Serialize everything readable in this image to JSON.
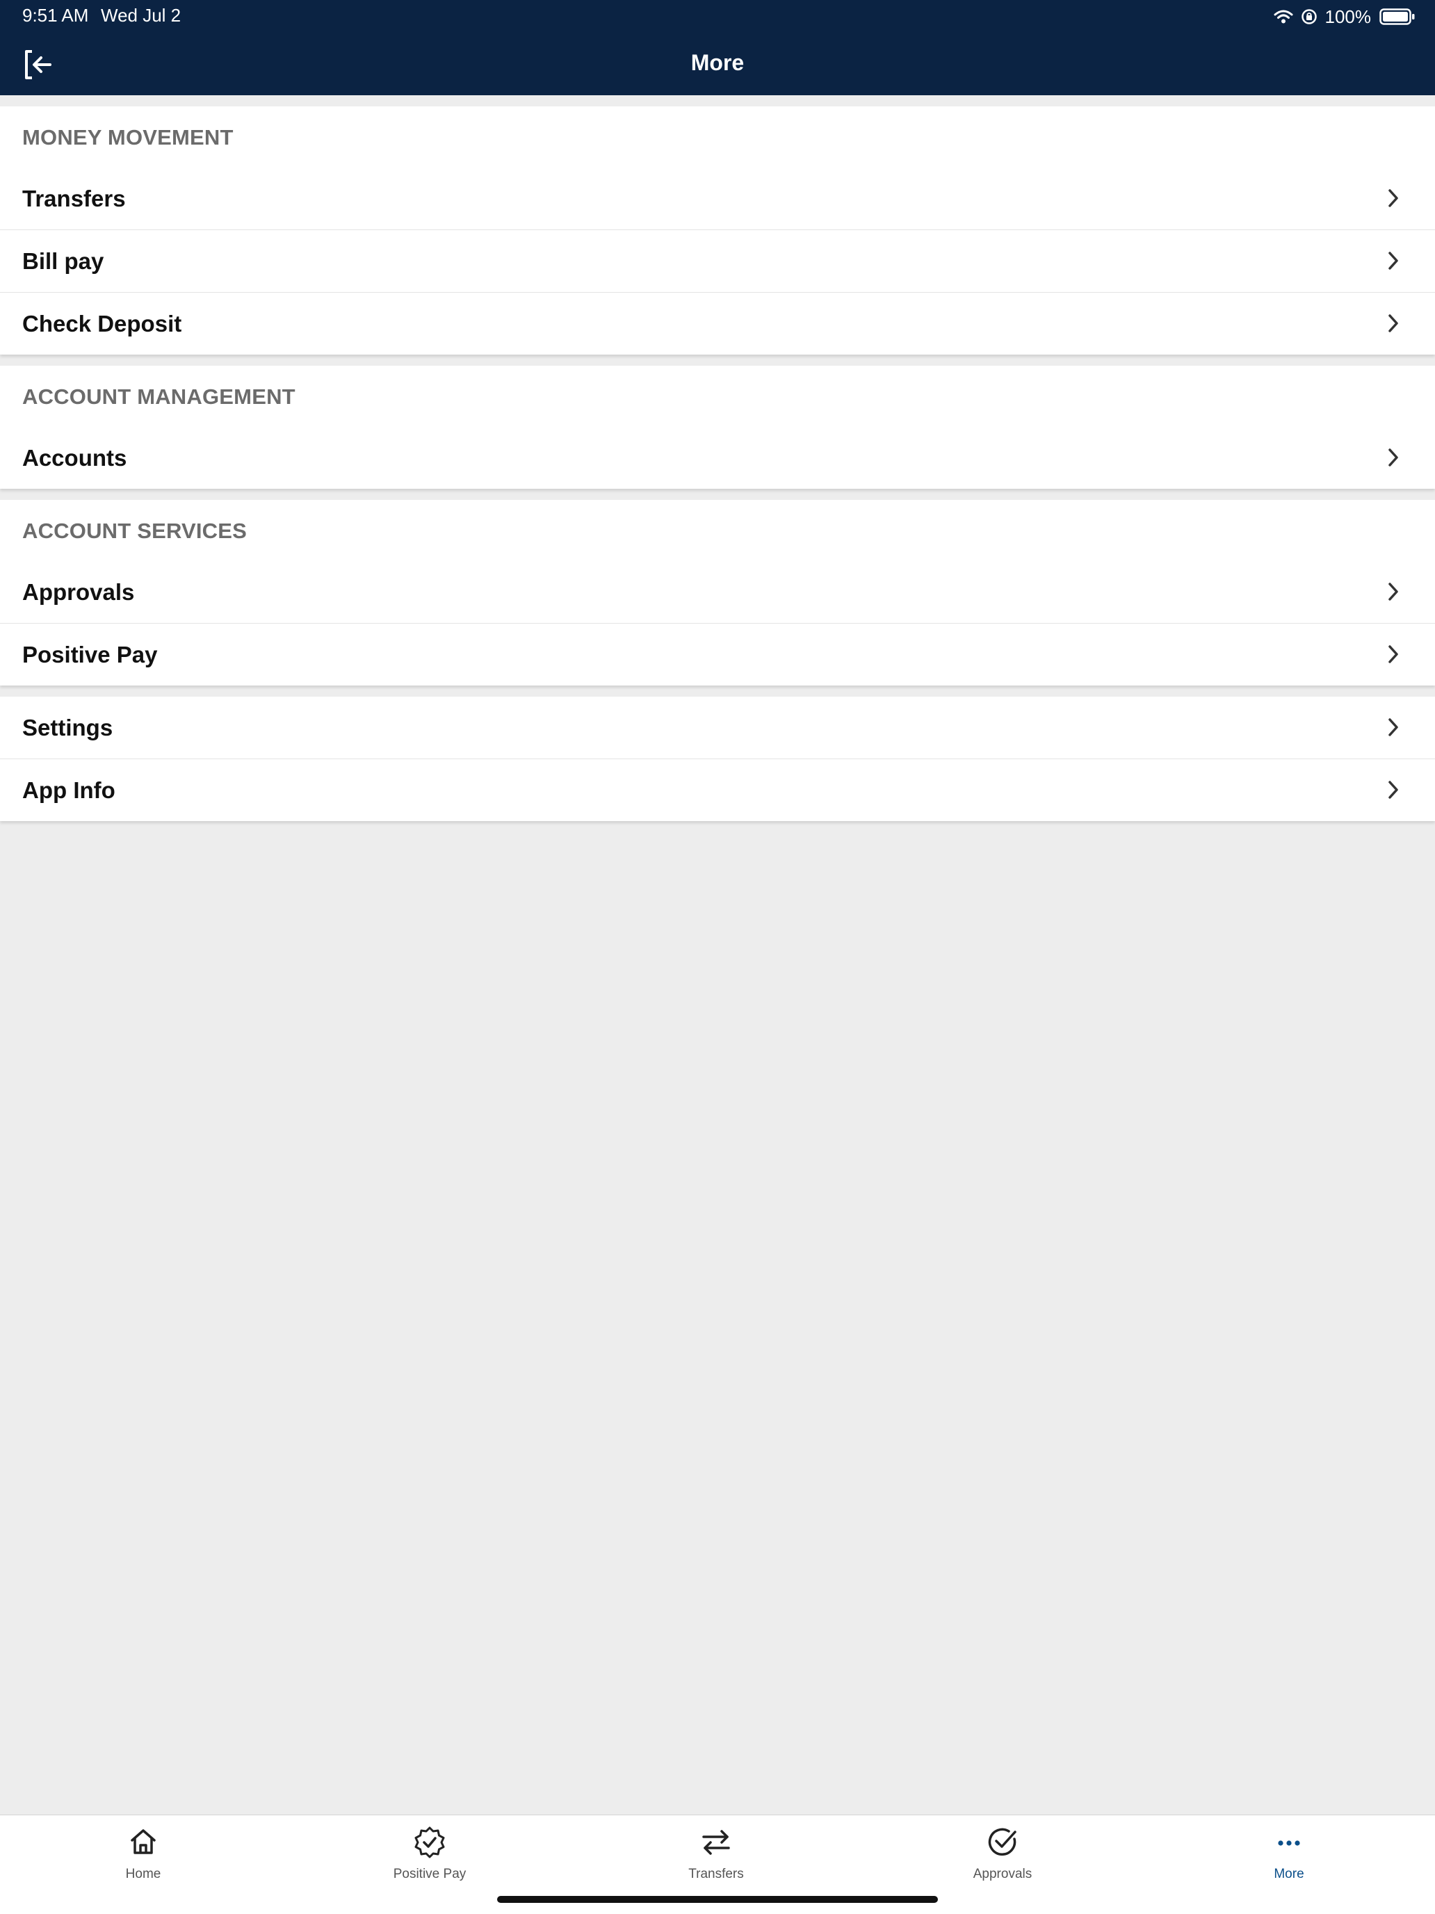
{
  "status_bar": {
    "time": "9:51 AM",
    "date": "Wed Jul 2",
    "battery": "100%"
  },
  "header": {
    "title": "More"
  },
  "sections": [
    {
      "title": "MONEY MOVEMENT",
      "items": [
        {
          "label": "Transfers"
        },
        {
          "label": "Bill pay"
        },
        {
          "label": "Check Deposit"
        }
      ]
    },
    {
      "title": "ACCOUNT MANAGEMENT",
      "items": [
        {
          "label": "Accounts"
        }
      ]
    },
    {
      "title": "ACCOUNT SERVICES",
      "items": [
        {
          "label": "Approvals"
        },
        {
          "label": "Positive Pay"
        }
      ]
    },
    {
      "title": "",
      "items": [
        {
          "label": "Settings"
        },
        {
          "label": "App Info"
        }
      ]
    }
  ],
  "tabbar": {
    "active": "More",
    "tabs": [
      {
        "label": "Home",
        "icon": "home-icon"
      },
      {
        "label": "Positive Pay",
        "icon": "badge-check-icon"
      },
      {
        "label": "Transfers",
        "icon": "transfer-arrows-icon"
      },
      {
        "label": "Approvals",
        "icon": "check-circle-icon"
      },
      {
        "label": "More",
        "icon": "more-dots-icon"
      }
    ]
  },
  "colors": {
    "header_bg": "#0b2343",
    "page_bg": "#ededed",
    "active_tab": "#0b4f8a",
    "section_title": "#6b6b6b"
  }
}
